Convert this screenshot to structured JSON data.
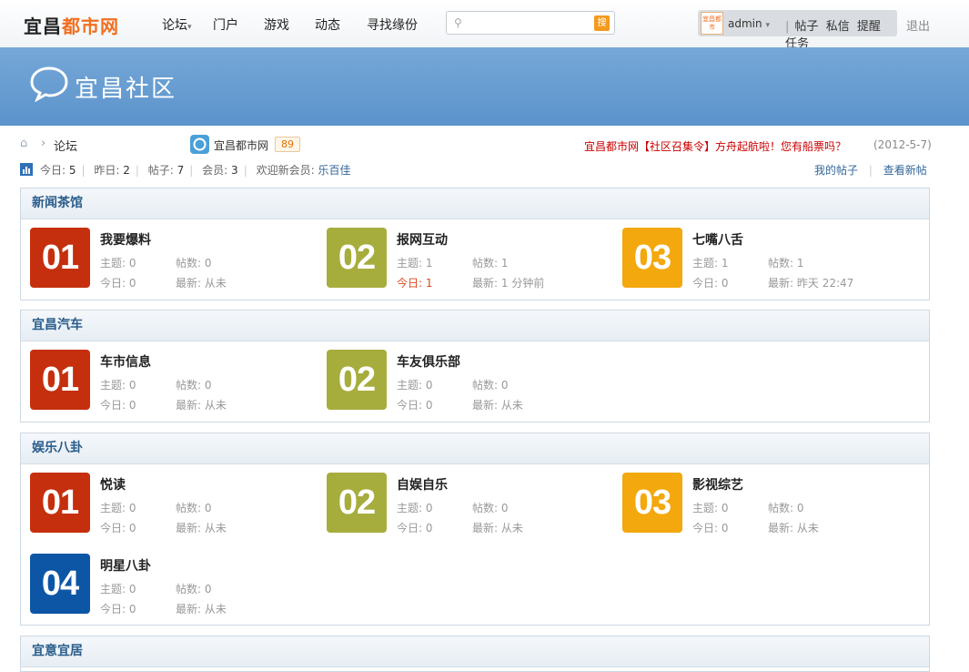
{
  "topnav": {
    "logo_part1": "宜昌",
    "logo_part2": "都市网",
    "nav_items": [
      "论坛",
      "门户",
      "游戏",
      "动态",
      "寻找缘份"
    ],
    "search_button": "搜",
    "avatar_text": "宜昌都市",
    "username": "admin",
    "user_links": [
      "帖子",
      "私信",
      "提醒",
      "任务"
    ],
    "logout": "退出"
  },
  "banner": {
    "title": "宜昌社区"
  },
  "breadcrumb": {
    "home": "⌂",
    "sep": "›",
    "forum": "论坛"
  },
  "site_link": {
    "label": "宜昌都市网",
    "count": "89"
  },
  "notice": {
    "text": "宜昌都市网【社区召集令】方舟起航啦！您有船票吗？",
    "date": "(2012-5-7)"
  },
  "stats": {
    "today_label": "今日:",
    "today": "5",
    "yesterday_label": "昨日:",
    "yesterday": "2",
    "posts_label": "帖子:",
    "posts": "7",
    "members_label": "会员:",
    "members": "3",
    "welcome_label": "欢迎新会员:",
    "new_member": "乐百佳"
  },
  "links": {
    "my_posts": "我的帖子",
    "new_posts": "查看新帖"
  },
  "labels": {
    "threads": "主题:",
    "posts": "帖数:",
    "today": "今日:",
    "latest": "最新:"
  },
  "sections": [
    {
      "title": "新闻茶馆",
      "forums": [
        {
          "num": "01",
          "name": "我要爆料",
          "threads": "0",
          "posts": "0",
          "today": "0",
          "latest": "从未"
        },
        {
          "num": "02",
          "name": "报网互动",
          "threads": "1",
          "posts": "1",
          "today": "1",
          "latest": "1 分钟前"
        },
        {
          "num": "03",
          "name": "七嘴八舌",
          "threads": "1",
          "posts": "1",
          "today": "0",
          "latest": "昨天 22:47"
        }
      ]
    },
    {
      "title": "宜昌汽车",
      "forums": [
        {
          "num": "01",
          "name": "车市信息",
          "threads": "0",
          "posts": "0",
          "today": "0",
          "latest": "从未"
        },
        {
          "num": "02",
          "name": "车友俱乐部",
          "threads": "0",
          "posts": "0",
          "today": "0",
          "latest": "从未"
        }
      ]
    },
    {
      "title": "娱乐八卦",
      "forums": [
        {
          "num": "01",
          "name": "悦读",
          "threads": "0",
          "posts": "0",
          "today": "0",
          "latest": "从未"
        },
        {
          "num": "02",
          "name": "自娱自乐",
          "threads": "0",
          "posts": "0",
          "today": "0",
          "latest": "从未"
        },
        {
          "num": "03",
          "name": "影视综艺",
          "threads": "0",
          "posts": "0",
          "today": "0",
          "latest": "从未"
        },
        {
          "num": "04",
          "name": "明星八卦",
          "threads": "0",
          "posts": "0",
          "today": "0",
          "latest": "从未"
        }
      ]
    },
    {
      "title": "宜意宜居",
      "forums": []
    }
  ]
}
